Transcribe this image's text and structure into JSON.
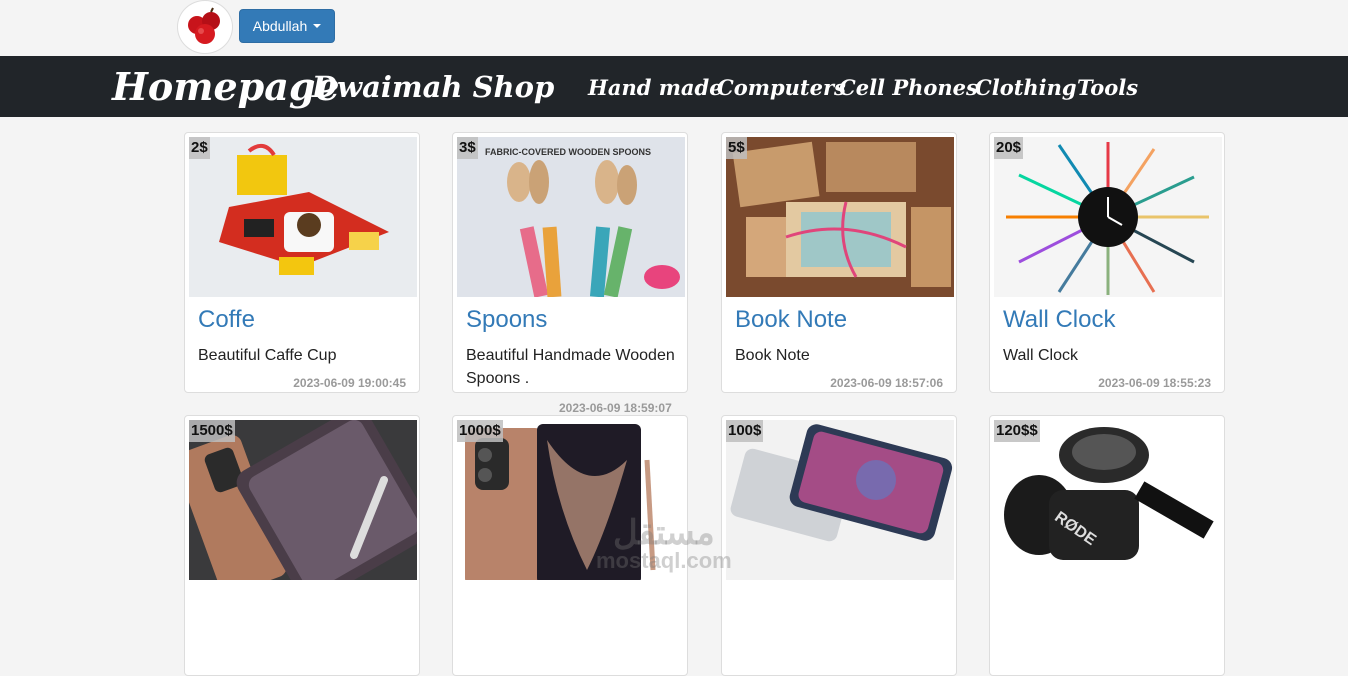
{
  "user": {
    "avatar_icon": "apples-avatar-icon",
    "name": "Abdullah",
    "dropdown_icon": "caret-down-icon"
  },
  "navbar": {
    "brand": "Homepage",
    "shop_name": "Dwaimah Shop",
    "links": [
      "Hand made",
      "Computers",
      "Cell Phones",
      "Clothing",
      "Tools"
    ]
  },
  "products": [
    {
      "price": "2$",
      "title": "Coffe",
      "description": "Beautiful Caffe Cup",
      "date": "2023-06-09 19:00:45",
      "image_icon": "gift-box-mug-image"
    },
    {
      "price": "3$",
      "title": "Spoons",
      "description": "Beautiful Handmade Wooden Spoons .",
      "date": "2023-06-09 18:59:07",
      "image_icon": "wooden-spoons-image",
      "image_caption": "FABRIC-COVERED WOODEN SPOONS"
    },
    {
      "price": "5$",
      "title": "Book Note",
      "description": "Book Note",
      "date": "2023-06-09 18:57:06",
      "image_icon": "notebooks-image"
    },
    {
      "price": "20$",
      "title": "Wall Clock",
      "description": "Wall Clock",
      "date": "2023-06-09 18:55:23",
      "image_icon": "pencil-wall-clock-image"
    },
    {
      "price": "1500$",
      "title": "",
      "description": "",
      "date": "",
      "image_icon": "phone-bronze-image"
    },
    {
      "price": "1000$",
      "title": "",
      "description": "",
      "date": "",
      "image_icon": "phone-note-image"
    },
    {
      "price": "100$",
      "title": "",
      "description": "",
      "date": "",
      "image_icon": "phone-silver-image"
    },
    {
      "price": "120$$",
      "title": "",
      "description": "",
      "date": "",
      "image_icon": "rode-mic-image",
      "image_caption": "RØDE"
    }
  ],
  "watermark": {
    "arabic": "مستقل",
    "latin": "mostaql.com"
  }
}
